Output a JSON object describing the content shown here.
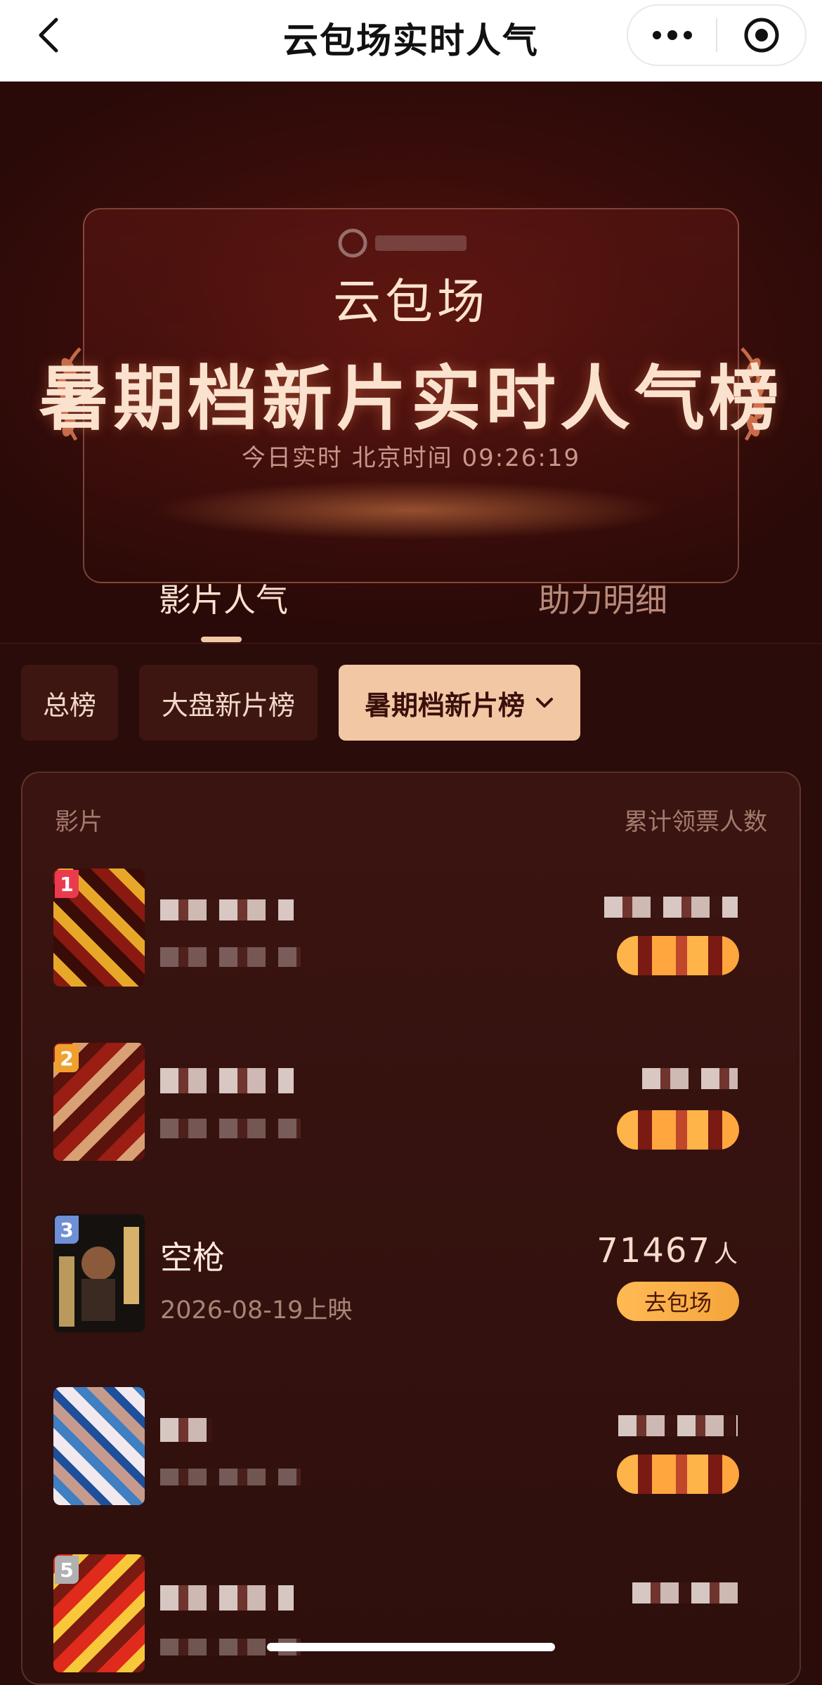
{
  "navbar": {
    "title": "云包场实时人气",
    "more_icon": "more-dots-icon",
    "close_icon": "target-close-icon"
  },
  "hero": {
    "subtitle": "云包场",
    "title": "暑期档新片实时人气榜",
    "time_text": "今日实时 北京时间 09:26:19"
  },
  "tabs": [
    {
      "label": "影片人气",
      "active": true
    },
    {
      "label": "助力明细",
      "active": false
    }
  ],
  "filters": [
    {
      "label": "总榜",
      "selected": false
    },
    {
      "label": "大盘新片榜",
      "selected": false
    },
    {
      "label": "暑期档新片榜",
      "selected": true
    }
  ],
  "list": {
    "header_left": "影片",
    "header_right": "累计领票人数",
    "items": [
      {
        "rank": "1",
        "rank_color": "#ea3a4e",
        "name": "",
        "release": "",
        "count": "",
        "unit": "",
        "button": "",
        "redacted": true
      },
      {
        "rank": "2",
        "rank_color": "#f0a02e",
        "name": "",
        "release": "",
        "count": "",
        "unit": "",
        "button": "",
        "redacted": true
      },
      {
        "rank": "3",
        "rank_color": "#6f8fd6",
        "name": "空枪",
        "release": "2026-08-19上映",
        "count": "71467",
        "unit": "人",
        "button": "去包场",
        "redacted": false
      },
      {
        "rank": "",
        "rank_color": "#b0b0b0",
        "name": "",
        "release": "",
        "count": "",
        "unit": "",
        "button": "",
        "redacted": true
      },
      {
        "rank": "5",
        "rank_color": "#b0b0b0",
        "name": "",
        "release": "",
        "count": "",
        "unit": "",
        "button": "",
        "redacted": true
      }
    ]
  },
  "colors": {
    "accent": "#f2c7a4",
    "button": "#ffb449",
    "background": "#2a0c0a"
  }
}
